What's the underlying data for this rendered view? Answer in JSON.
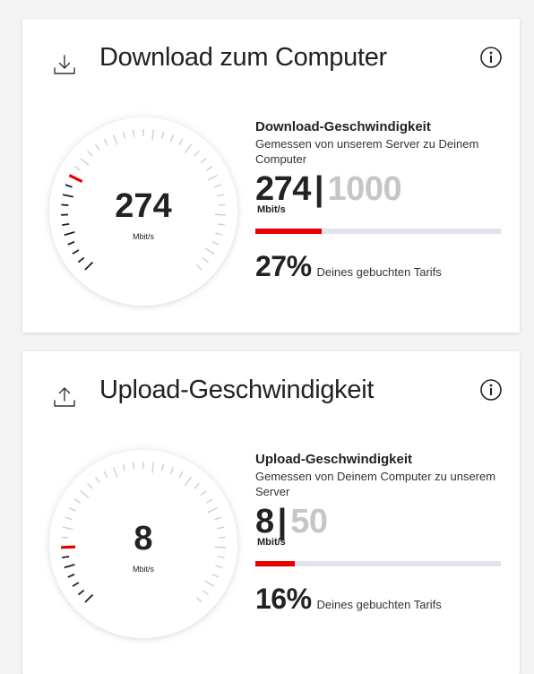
{
  "download": {
    "title": "Download zum Computer",
    "icon": "download-icon",
    "info_icon": "info-icon",
    "gauge": {
      "value": "274",
      "unit": "Mbit/s",
      "fraction": 0.274
    },
    "info": {
      "title": "Download-Geschwindigkeit",
      "subtitle": "Gemessen von unserem Server zu Deinem Computer",
      "current": "274",
      "separator": "|",
      "max": "1000",
      "unit": "Mbit/s",
      "percent_value": "27%",
      "percent_fraction": 0.27,
      "percent_label": "Deines gebuchten Tarifs"
    }
  },
  "upload": {
    "title": "Upload-Geschwindigkeit",
    "icon": "upload-icon",
    "info_icon": "info-icon",
    "gauge": {
      "value": "8",
      "unit": "Mbit/s",
      "fraction": 0.16
    },
    "info": {
      "title": "Upload-Geschwindigkeit",
      "subtitle": "Gemessen von Deinem Computer zu unserem Server",
      "current": "8",
      "separator": "|",
      "max": "50",
      "unit": "Mbit/s",
      "percent_value": "16%",
      "percent_fraction": 0.16,
      "percent_label": "Deines gebuchten Tarifs"
    }
  },
  "colors": {
    "accent": "#e60000",
    "tick_active": "#222222",
    "tick_inactive": "#cccccc",
    "bar_track": "#e0e3ea",
    "max_text": "#c6c6c6"
  }
}
